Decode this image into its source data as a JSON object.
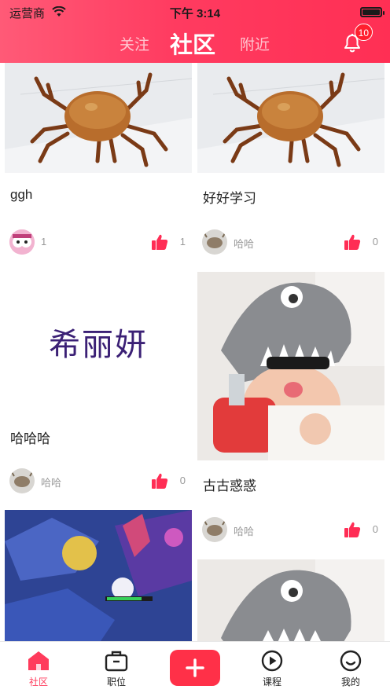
{
  "status_bar": {
    "carrier": "运营商",
    "time": "下午 3:14"
  },
  "header": {
    "tabs": [
      {
        "label": "关注"
      },
      {
        "label": "社区"
      },
      {
        "label": "附近"
      }
    ],
    "notification_count": "10"
  },
  "feed": {
    "posts": [
      {
        "title": "ggh",
        "user": "1",
        "likes": "1",
        "image": "crab-photo"
      },
      {
        "title": "好好学习",
        "user": "哈哈",
        "likes": "0",
        "image": "crab-photo"
      },
      {
        "title": "哈哈哈",
        "user": "哈哈",
        "likes": "0",
        "image": "text-image",
        "image_text": "希丽妍"
      },
      {
        "title": "古古惑惑",
        "user": "哈哈",
        "likes": "0",
        "image": "child-with-hat-photo"
      },
      {
        "image": "game-screenshot"
      },
      {
        "image": "child-with-hat-photo"
      }
    ]
  },
  "bottom_nav": {
    "items": [
      {
        "label": "社区",
        "icon": "home-icon",
        "active": true
      },
      {
        "label": "职位",
        "icon": "briefcase-icon"
      },
      {
        "label": "",
        "icon": "plus-icon"
      },
      {
        "label": "课程",
        "icon": "play-circle-icon"
      },
      {
        "label": "我的",
        "icon": "smiley-icon"
      }
    ]
  },
  "colors": {
    "accent": "#ff3b5c",
    "like": "#ff2d55",
    "header_start": "#ff5a77",
    "header_end": "#ff2f54"
  }
}
